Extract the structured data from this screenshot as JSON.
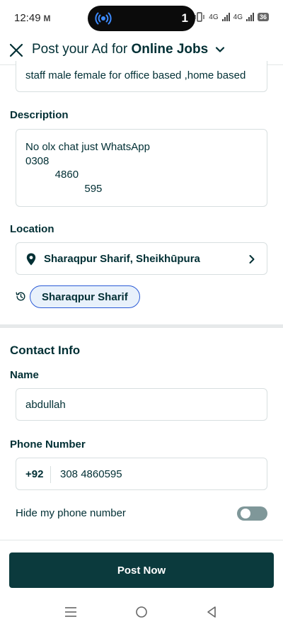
{
  "status_bar": {
    "time": "12:49",
    "mail_glyph": "M",
    "pill_count": "1",
    "network_1": "4G",
    "network_2": "4G",
    "battery": "36"
  },
  "header": {
    "title_prefix": "Post your Ad for ",
    "title_category": "Online Jobs"
  },
  "form": {
    "title_value": "staff male female for office based ,home based",
    "description_label": "Description",
    "description_value": "No olx chat just WhatsApp\n0308\n          4860\n                    595",
    "location_label": "Location",
    "location_value": "Sharaqpur Sharif, Sheikhūpura",
    "recent_location_chip": "Sharaqpur Sharif"
  },
  "contact": {
    "section_title": "Contact Info",
    "name_label": "Name",
    "name_value": "abdullah",
    "phone_label": "Phone Number",
    "phone_prefix": "+92",
    "phone_value": "308 4860595",
    "hide_phone_label": "Hide my phone number",
    "hide_phone_enabled": false
  },
  "actions": {
    "post_label": "Post Now"
  },
  "colors": {
    "primary": "#002f34",
    "button": "#0b3a3d",
    "chip_border": "#2a5ad6",
    "chip_bg": "#e8f1fb"
  },
  "icons": {
    "close": "close-icon",
    "category_dropdown": "chevron-down-icon",
    "location": "location-pin-icon",
    "location_chevron": "chevron-right-icon",
    "recent": "history-icon",
    "nav_menu": "menu-icon",
    "nav_home": "home-circle-icon",
    "nav_back": "back-triangle-icon"
  }
}
